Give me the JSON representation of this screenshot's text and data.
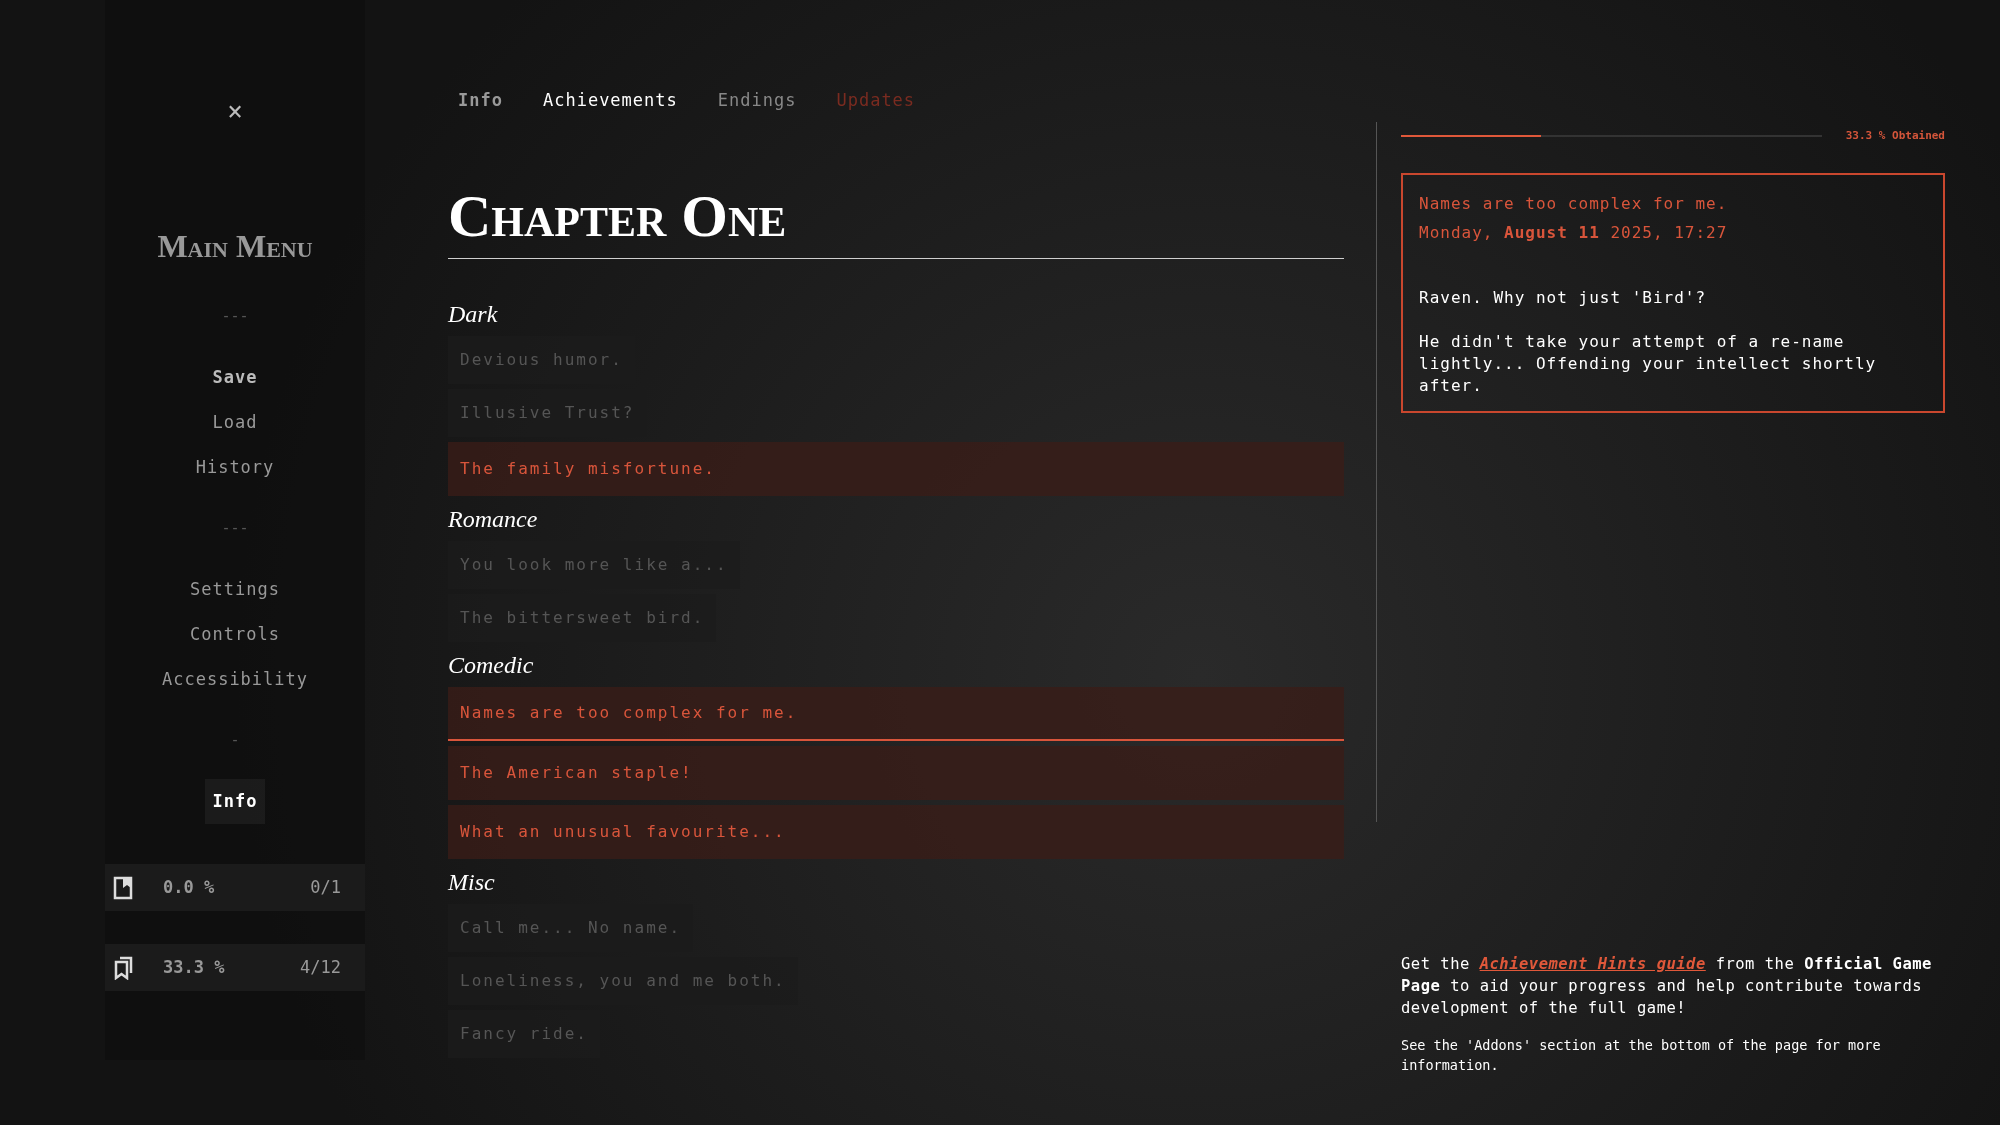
{
  "sidebar": {
    "close": "×",
    "title": "Main Menu",
    "items": [
      {
        "label": "---",
        "kind": "separator"
      },
      {
        "label": "Save",
        "kind": "item",
        "bold": true,
        "selected": false
      },
      {
        "label": "Load",
        "kind": "item",
        "bold": false,
        "selected": false
      },
      {
        "label": "History",
        "kind": "item",
        "bold": false,
        "selected": false
      },
      {
        "label": "---",
        "kind": "separator"
      },
      {
        "label": "Settings",
        "kind": "item",
        "bold": false,
        "selected": false
      },
      {
        "label": "Controls",
        "kind": "item",
        "bold": false,
        "selected": false
      },
      {
        "label": "Accessibility",
        "kind": "item",
        "bold": false,
        "selected": false
      },
      {
        "label": "-",
        "kind": "separator"
      },
      {
        "label": "Info",
        "kind": "item",
        "bold": true,
        "selected": true
      }
    ],
    "stats": [
      {
        "kind": "endings",
        "percent": "0.0 %",
        "count": "0/1"
      },
      {
        "kind": "achievements",
        "percent": "33.3 %",
        "count": "4/12"
      }
    ]
  },
  "tabs": [
    {
      "label": "Info",
      "kind": "bold",
      "selected": false
    },
    {
      "label": "Achievements",
      "kind": "plain",
      "selected": true
    },
    {
      "label": "Endings",
      "kind": "plain",
      "selected": false
    },
    {
      "label": "Updates",
      "kind": "accent",
      "selected": false
    }
  ],
  "chapter_title": "Chapter One",
  "sections": [
    {
      "heading": "Dark",
      "items": [
        {
          "label": "Devious humor.",
          "unlocked": false,
          "selected": false
        },
        {
          "label": "Illusive Trust?",
          "unlocked": false,
          "selected": false
        },
        {
          "label": "The family misfortune.",
          "unlocked": true,
          "selected": false
        }
      ]
    },
    {
      "heading": "Romance",
      "items": [
        {
          "label": "You look more like a...",
          "unlocked": false,
          "selected": false
        },
        {
          "label": "The bittersweet bird.",
          "unlocked": false,
          "selected": false
        }
      ]
    },
    {
      "heading": "Comedic",
      "items": [
        {
          "label": "Names are too complex for me.",
          "unlocked": true,
          "selected": true
        },
        {
          "label": "The American staple!",
          "unlocked": true,
          "selected": false
        },
        {
          "label": "What an unusual favourite...",
          "unlocked": true,
          "selected": false
        }
      ]
    },
    {
      "heading": "Misc",
      "items": [
        {
          "label": "Call me... No name.",
          "unlocked": false,
          "selected": false
        },
        {
          "label": "Loneliness, you and me both.",
          "unlocked": false,
          "selected": false
        },
        {
          "label": "Fancy ride.",
          "unlocked": false,
          "selected": false
        }
      ]
    }
  ],
  "progress": {
    "level": 0.333,
    "label": "33.3 % Obtained"
  },
  "detail": {
    "title": "Names are too complex for me.",
    "date": "Monday, **August 11** 2025, 17:27",
    "paragraphs": [
      "Raven. Why not just 'Bird'?",
      "He didn't take your attempt of a re-name lightly... Offending your intellect shortly after."
    ]
  },
  "footer": {
    "prefix": "Get the",
    "link": "Achievement Hints guide",
    "suffix": "from the **Official Game Page** to aid your progress and help contribute towards development of the full game!",
    "note": "See the 'Addons' section at the bottom of the page for more information."
  }
}
